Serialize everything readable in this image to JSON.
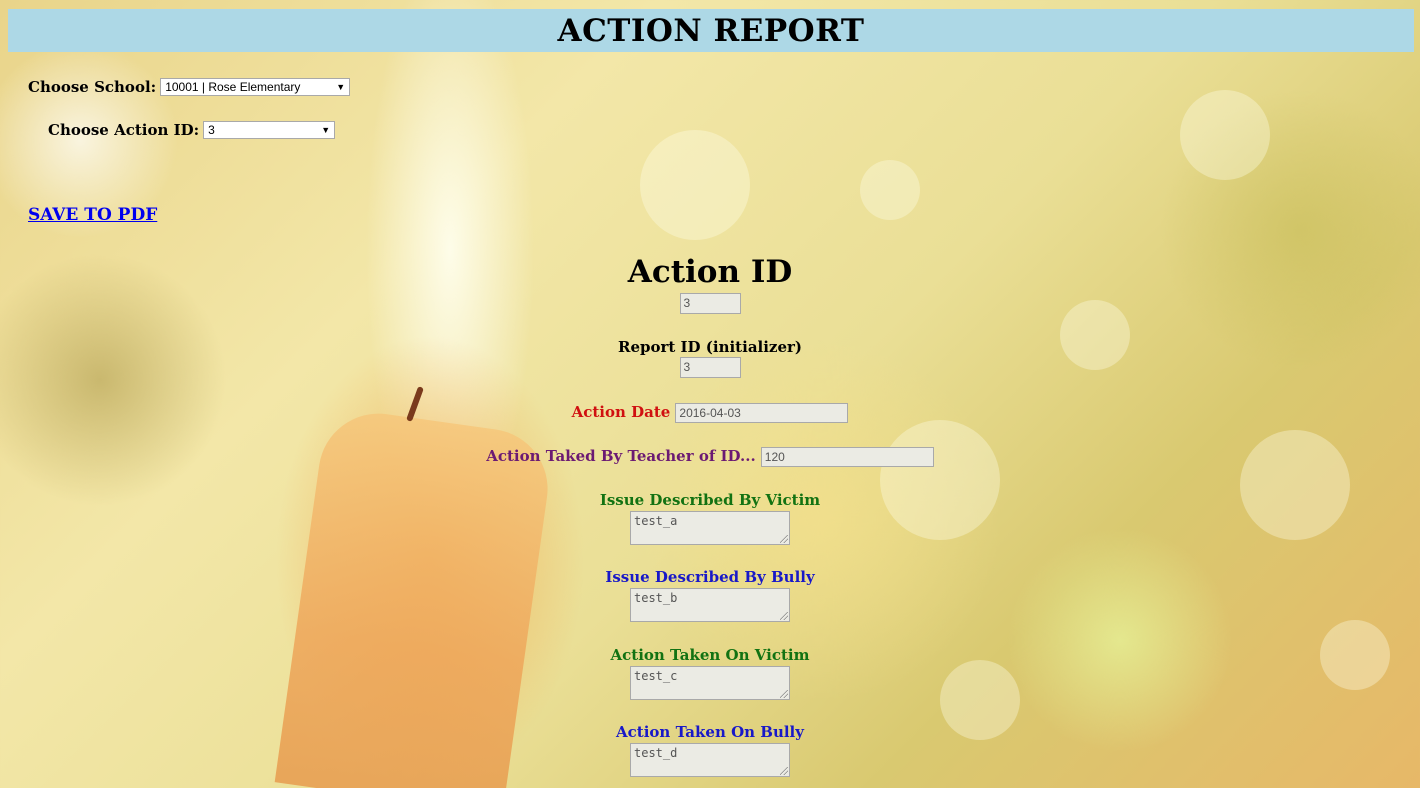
{
  "header": {
    "title": "ACTION REPORT"
  },
  "school_select": {
    "label": "Choose School:",
    "selected": "10001 | Rose Elementary"
  },
  "action_select": {
    "label": "Choose Action ID:",
    "selected": "3"
  },
  "save_link": {
    "label": "SAVE TO PDF"
  },
  "main": {
    "title": "Action ID",
    "action_id_value": "3",
    "report_id": {
      "label": "Report ID (initializer)",
      "value": "3"
    },
    "action_date": {
      "label": "Action Date",
      "value": "2016-04-03"
    },
    "teacher": {
      "label": "Action Taked By Teacher of ID...",
      "value": "120"
    },
    "issue_victim": {
      "label": "Issue Described By Victim",
      "value": "test_a"
    },
    "issue_bully": {
      "label": "Issue Described By Bully",
      "value": "test_b"
    },
    "action_victim": {
      "label": "Action Taken On Victim",
      "value": "test_c"
    },
    "action_bully": {
      "label": "Action Taken On Bully",
      "value": "test_d"
    }
  },
  "colors": {
    "header_bg": "#add8e6",
    "link": "#0000ee",
    "red_label": "#d01010",
    "purple_label": "#6b1a73",
    "green_label": "#127212",
    "blue_label": "#1818c8"
  }
}
